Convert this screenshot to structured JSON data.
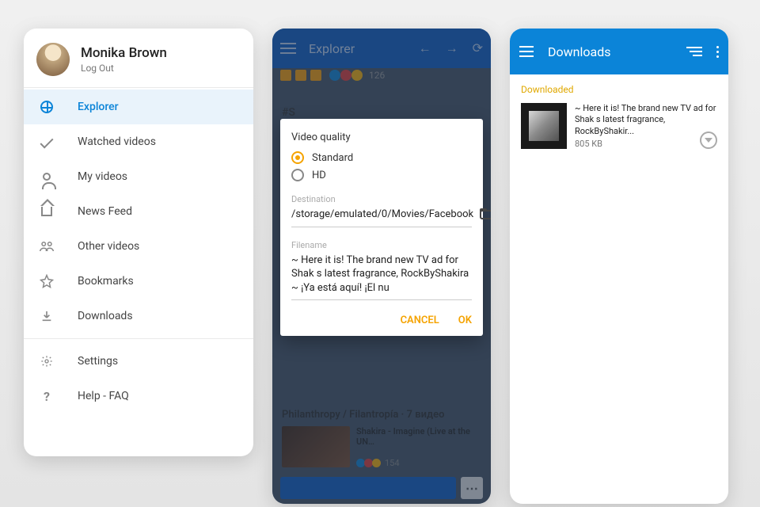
{
  "drawer": {
    "user_name": "Monika Brown",
    "logout_label": "Log Out",
    "items": [
      {
        "id": "explorer",
        "label": "Explorer",
        "icon": "globe-icon",
        "active": true
      },
      {
        "id": "watched",
        "label": "Watched videos",
        "icon": "check-icon"
      },
      {
        "id": "myvideos",
        "label": "My videos",
        "icon": "user-icon"
      },
      {
        "id": "news",
        "label": "News Feed",
        "icon": "home-icon"
      },
      {
        "id": "other",
        "label": "Other videos",
        "icon": "group-icon"
      },
      {
        "id": "bookmarks",
        "label": "Bookmarks",
        "icon": "star-icon"
      },
      {
        "id": "downloads",
        "label": "Downloads",
        "icon": "download-icon"
      }
    ],
    "settings_label": "Settings",
    "help_label": "Help - FAQ"
  },
  "explorer": {
    "topbar_title": "Explorer",
    "react_count": "126",
    "section_title": "Philanthropy / Filantropía · 7 видео",
    "video_title": "Shakira - Imagine (Live at the UN…",
    "video_react_count": "154",
    "hash89": "#S"
  },
  "dialog": {
    "heading": "Video quality",
    "option_standard": "Standard",
    "option_hd": "HD",
    "selected": "Standard",
    "dest_label": "Destination",
    "dest_value": "/storage/emulated/0/Movies/Facebook",
    "filename_label": "Filename",
    "filename_value": "~ Here it is! The brand new TV ad for Shak s latest fragrance, RockByShakira ~ ¡Ya está aquí! ¡El nu",
    "cancel": "CANCEL",
    "ok": "OK"
  },
  "downloads": {
    "topbar_title": "Downloads",
    "section_label": "Downloaded",
    "item_title": "~ Here it is! The brand new TV ad for Shak s latest fragrance, RockByShakir...",
    "item_size": "805 KB"
  }
}
